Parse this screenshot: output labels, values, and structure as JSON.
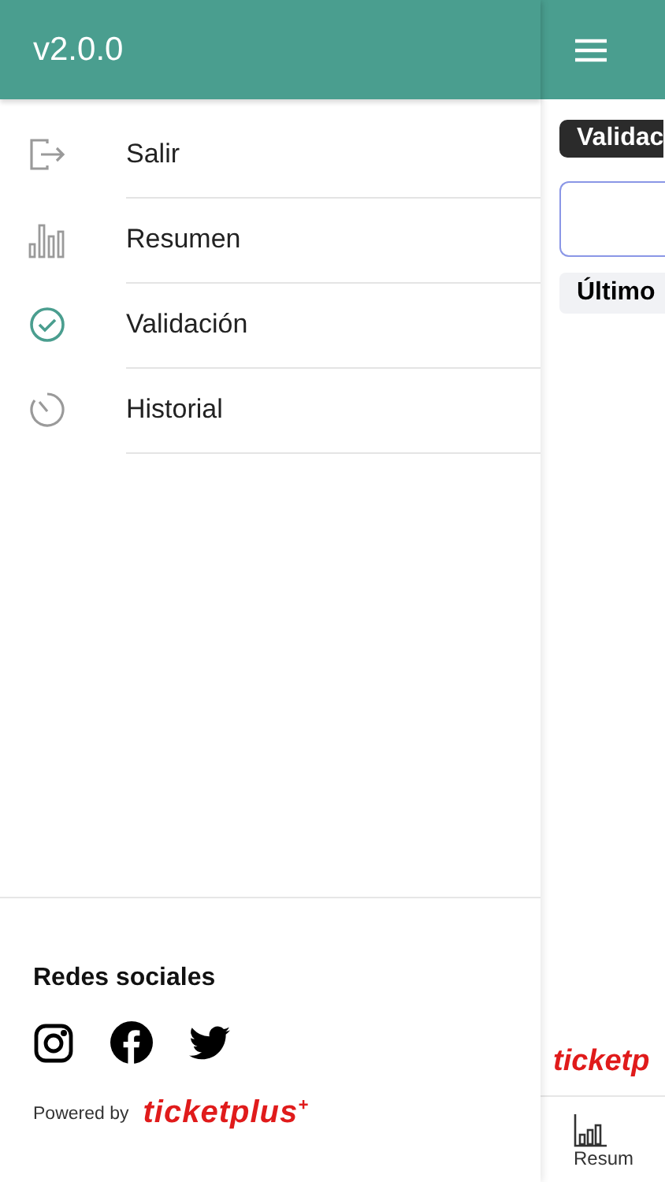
{
  "drawer": {
    "version": "v2.0.0",
    "items": [
      {
        "label": "Salir",
        "kind": "exit",
        "selected": false
      },
      {
        "label": "Resumen",
        "kind": "chart",
        "selected": false
      },
      {
        "label": "Validación",
        "kind": "check",
        "selected": true
      },
      {
        "label": "Historial",
        "kind": "timer",
        "selected": false
      }
    ],
    "social_title": "Redes sociales",
    "social": [
      {
        "kind": "instagram"
      },
      {
        "kind": "facebook"
      },
      {
        "kind": "twitter"
      }
    ],
    "powered_by": "Powered by",
    "brand": "ticketplus$^{+}$"
  },
  "main": {
    "chip": "Validac",
    "last_label": "Último",
    "brand": "ticketp",
    "nav": [
      {
        "label": "Resum",
        "kind": "chart"
      }
    ]
  }
}
